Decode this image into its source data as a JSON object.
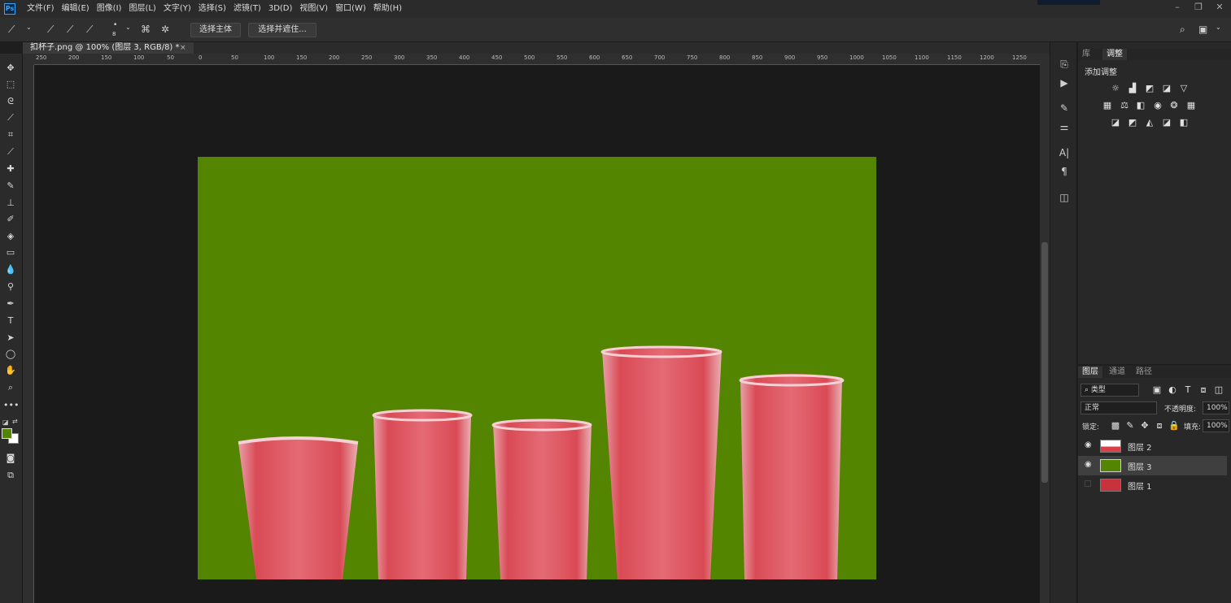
{
  "app": {
    "logo": "Ps"
  },
  "menu": [
    "文件(F)",
    "编辑(E)",
    "图像(I)",
    "图层(L)",
    "文字(Y)",
    "选择(S)",
    "滤镜(T)",
    "3D(D)",
    "视图(V)",
    "窗口(W)",
    "帮助(H)"
  ],
  "options": {
    "brush_size": "8",
    "select_subject": "选择主体",
    "select_and_mask": "选择并遮住..."
  },
  "document": {
    "tab_title": "扣杯子.png @ 100% (图层 3, RGB/8) *",
    "close": "×",
    "background_color": "#548500"
  },
  "ruler_h": [
    "250",
    "200",
    "150",
    "100",
    "50",
    "0",
    "50",
    "100",
    "150",
    "200",
    "250",
    "300",
    "350",
    "400",
    "450",
    "500",
    "550",
    "600",
    "650",
    "700",
    "750",
    "800",
    "850",
    "900",
    "950",
    "1000",
    "1050",
    "1100",
    "1150",
    "1200",
    "1250"
  ],
  "panels": {
    "tabs_top": [
      "库",
      "调整"
    ],
    "adjustments_title": "添加调整",
    "tabs_layers": [
      "图层",
      "通道",
      "路径"
    ],
    "filter_kind": "类型",
    "blend_mode": "正常",
    "opacity_label": "不透明度:",
    "opacity_value": "100%",
    "lock_label": "锁定:",
    "fill_label": "填充:",
    "fill_value": "100%",
    "layers": [
      {
        "name": "图层 2",
        "visible": true,
        "selected": false
      },
      {
        "name": "图层 3",
        "visible": true,
        "selected": true
      },
      {
        "name": "图层 1",
        "visible": false,
        "selected": false
      }
    ]
  },
  "colors": {
    "foreground": "#548500",
    "background": "#ffffff",
    "accent": "#31a8ff"
  }
}
